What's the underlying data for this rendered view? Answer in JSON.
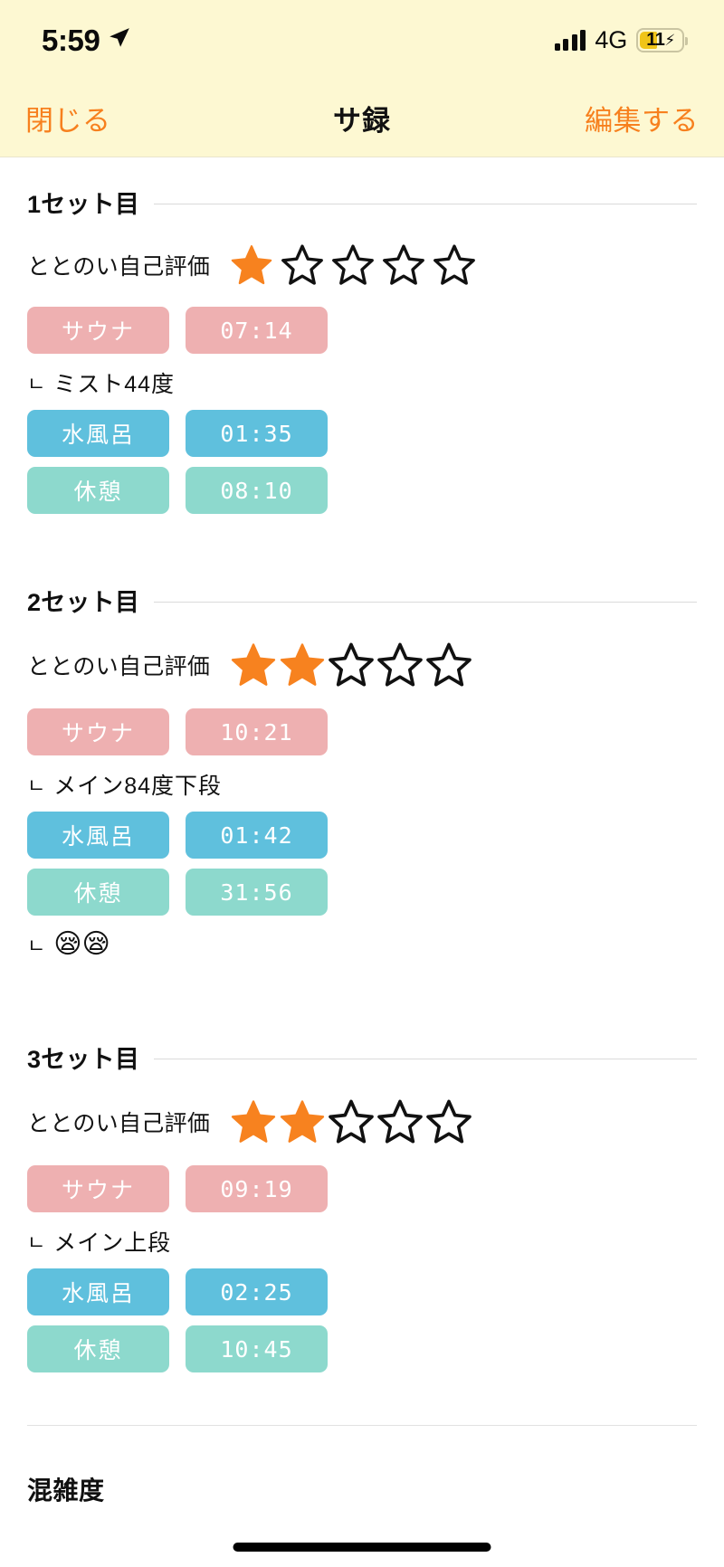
{
  "status_bar": {
    "time": "5:59",
    "location_icon": "location-arrow-icon",
    "signal_icon": "cellular-signal-icon",
    "network": "4G",
    "battery_level": "11",
    "battery_charging_icon": "lightning-bolt-icon"
  },
  "nav": {
    "close_label": "閉じる",
    "title": "サ録",
    "edit_label": "編集する"
  },
  "rating_label": "ととのい自己評価",
  "sets": [
    {
      "title": "1セット目",
      "rating": 1,
      "max_rating": 5,
      "rows": [
        {
          "type": "sauna",
          "label": "サウナ",
          "time": "07:14"
        }
      ],
      "sauna_note": "ミスト44度",
      "cold": {
        "label": "水風呂",
        "time": "01:35"
      },
      "rest": {
        "label": "休憩",
        "time": "08:10"
      },
      "rest_note": ""
    },
    {
      "title": "2セット目",
      "rating": 2,
      "max_rating": 5,
      "rows": [
        {
          "type": "sauna",
          "label": "サウナ",
          "time": "10:21"
        }
      ],
      "sauna_note": "メイン84度下段",
      "cold": {
        "label": "水風呂",
        "time": "01:42"
      },
      "rest": {
        "label": "休憩",
        "time": "31:56"
      },
      "rest_note": "😪😪"
    },
    {
      "title": "3セット目",
      "rating": 2,
      "max_rating": 5,
      "rows": [
        {
          "type": "sauna",
          "label": "サウナ",
          "time": "09:19"
        }
      ],
      "sauna_note": "メイン上段",
      "cold": {
        "label": "水風呂",
        "time": "02:25"
      },
      "rest": {
        "label": "休憩",
        "time": "10:45"
      },
      "rest_note": ""
    }
  ],
  "bottom": {
    "congestion_title": "混雑度"
  },
  "note_prefix": "ㄴ",
  "colors": {
    "accent": "#f7801e",
    "header_bg": "#fdf8d2",
    "sauna_pill": "#eeb0b1",
    "cold_pill": "#5fc0dd",
    "rest_pill": "#8dd9cd",
    "star_filled": "#f7821f",
    "star_empty_stroke": "#111111",
    "battery_fill": "#f0c419"
  }
}
